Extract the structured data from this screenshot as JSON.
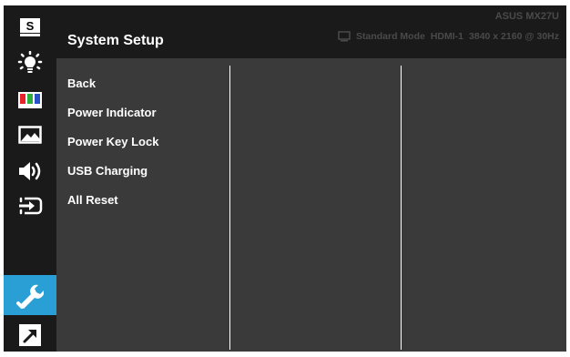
{
  "header": {
    "title": "System Setup",
    "model": "ASUS MX27U",
    "mode": "Standard Mode",
    "input": "HDMI-1",
    "resolution": "3840 x 2160 @ 30Hz"
  },
  "sidebar": {
    "items": [
      {
        "icon": "splendid-s-icon",
        "label": "S"
      },
      {
        "icon": "brightness-icon"
      },
      {
        "icon": "color-icon"
      },
      {
        "icon": "image-icon"
      },
      {
        "icon": "sound-icon"
      },
      {
        "icon": "input-select-icon"
      },
      {
        "icon": "system-setup-icon",
        "active": true
      },
      {
        "icon": "shortcut-icon"
      }
    ]
  },
  "menu": {
    "items": [
      "Back",
      "Power Indicator",
      "Power Key Lock",
      "USB Charging",
      "All Reset"
    ]
  },
  "colors": {
    "accent": "#2a9fd6",
    "background": "#3a3a3a",
    "sidebar": "#1a1a1a"
  }
}
